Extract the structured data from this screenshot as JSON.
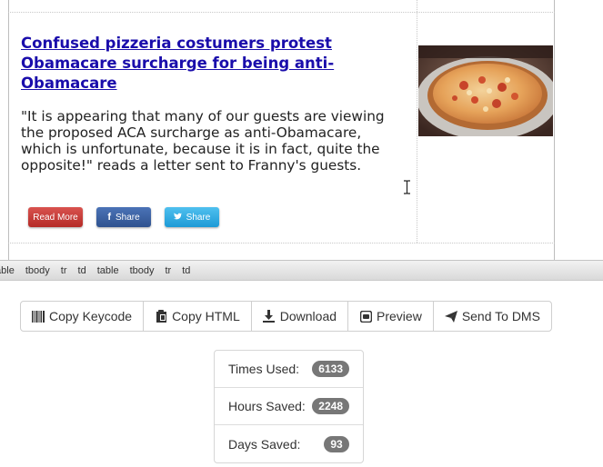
{
  "article": {
    "title": "Confused pizzeria costumers protest Obamacare surcharge for being anti-Obamacare",
    "body": "\"It is appearing that many of our guests are viewing the proposed ACA surcharge as anti-Obamacare, which is unfortunate, because it is in fact, quite the opposite!\" reads a letter sent to Franny's guests.",
    "read_more_label": "Read More",
    "facebook_share_label": "Share",
    "twitter_share_label": "Share",
    "image_icon": "pizza-photo"
  },
  "tag_path": [
    "table",
    "tbody",
    "tr",
    "td",
    "table",
    "tbody",
    "tr",
    "td"
  ],
  "toolbar": {
    "copy_keycode": {
      "label": "Copy Keycode",
      "icon": "barcode-icon"
    },
    "copy_html": {
      "label": "Copy HTML",
      "icon": "clipboard-icon"
    },
    "download": {
      "label": "Download",
      "icon": "download-icon"
    },
    "preview": {
      "label": "Preview",
      "icon": "preview-icon"
    },
    "send_to_dms": {
      "label": "Send To DMS",
      "icon": "send-icon"
    }
  },
  "stats": [
    {
      "label": "Times Used:",
      "value": "6133"
    },
    {
      "label": "Hours Saved:",
      "value": "2248"
    },
    {
      "label": "Days Saved:",
      "value": "93"
    }
  ],
  "colors": {
    "link": "#1a0dab",
    "read_more": "#c9302c",
    "facebook": "#3b5998",
    "twitter": "#2fb0e8",
    "badge": "#777777"
  }
}
